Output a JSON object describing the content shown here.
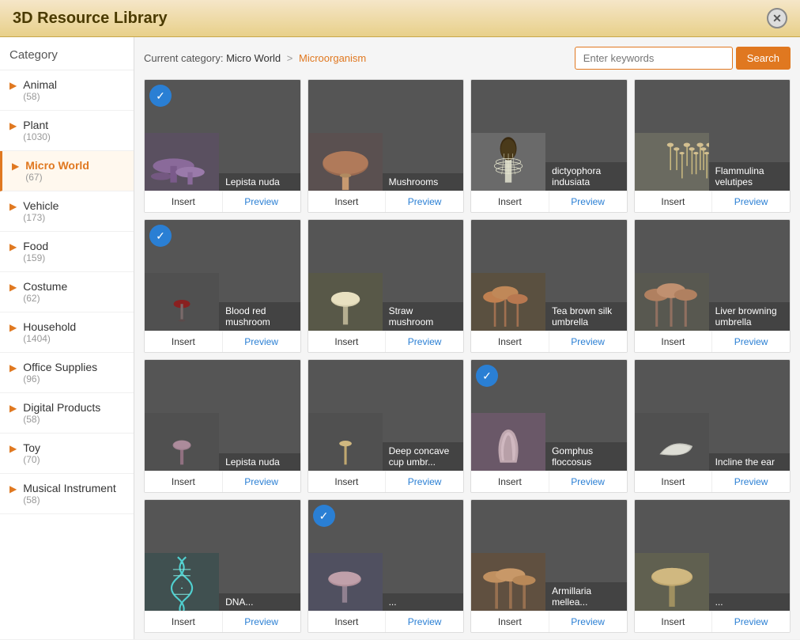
{
  "app": {
    "title": "3D Resource Library"
  },
  "sidebar": {
    "header": "Category",
    "items": [
      {
        "id": "animal",
        "name": "Animal",
        "count": "(58)",
        "active": false
      },
      {
        "id": "plant",
        "name": "Plant",
        "count": "(1030)",
        "active": false
      },
      {
        "id": "micro-world",
        "name": "Micro World",
        "count": "(67)",
        "active": true
      },
      {
        "id": "vehicle",
        "name": "Vehicle",
        "count": "(173)",
        "active": false
      },
      {
        "id": "food",
        "name": "Food",
        "count": "(159)",
        "active": false
      },
      {
        "id": "costume",
        "name": "Costume",
        "count": "(62)",
        "active": false
      },
      {
        "id": "household",
        "name": "Household",
        "count": "(1404)",
        "active": false
      },
      {
        "id": "office-supplies",
        "name": "Office Supplies",
        "count": "(96)",
        "active": false
      },
      {
        "id": "digital-products",
        "name": "Digital Products",
        "count": "(58)",
        "active": false
      },
      {
        "id": "toy",
        "name": "Toy",
        "count": "(70)",
        "active": false
      },
      {
        "id": "musical-instrument",
        "name": "Musical Instrument",
        "count": "(58)",
        "active": false
      }
    ]
  },
  "breadcrumb": {
    "label": "Current category:",
    "category": "Micro World",
    "arrow": ">",
    "subcategory": "Microorganism"
  },
  "search": {
    "placeholder": "Enter keywords",
    "button_label": "Search"
  },
  "grid": {
    "items": [
      {
        "id": 1,
        "name": "Lepista nuda",
        "badge": true,
        "insert": "Insert",
        "preview": "Preview",
        "color": "#6a5a7a"
      },
      {
        "id": 2,
        "name": "Mushrooms",
        "badge": false,
        "insert": "Insert",
        "preview": "Preview",
        "color": "#7a5a4a"
      },
      {
        "id": 3,
        "name": "dictyophora indusiata",
        "badge": false,
        "insert": "Insert",
        "preview": "Preview",
        "color": "#8a8a7a"
      },
      {
        "id": 4,
        "name": "Flammulina velutipes",
        "badge": false,
        "insert": "Insert",
        "preview": "Preview",
        "color": "#7a7a6a"
      },
      {
        "id": 5,
        "name": "Blood red mushroom",
        "badge": true,
        "insert": "Insert",
        "preview": "Preview",
        "color": "#5a5a5a"
      },
      {
        "id": 6,
        "name": "Straw mushroom",
        "badge": false,
        "insert": "Insert",
        "preview": "Preview",
        "color": "#6a6a5a"
      },
      {
        "id": 7,
        "name": "Tea brown silk umbrella",
        "badge": false,
        "insert": "Insert",
        "preview": "Preview",
        "color": "#7a6a4a"
      },
      {
        "id": 8,
        "name": "Liver browning umbrella",
        "badge": false,
        "insert": "Insert",
        "preview": "Preview",
        "color": "#7a6a5a"
      },
      {
        "id": 9,
        "name": "Lepista nuda",
        "badge": false,
        "insert": "Insert",
        "preview": "Preview",
        "color": "#5a5a5a"
      },
      {
        "id": 10,
        "name": "Deep concave cup umbr...",
        "badge": false,
        "insert": "Insert",
        "preview": "Preview",
        "color": "#5a5a5a"
      },
      {
        "id": 11,
        "name": "Gomphus floccosus",
        "badge": true,
        "insert": "Insert",
        "preview": "Preview",
        "color": "#6a5a6a"
      },
      {
        "id": 12,
        "name": "Incline the ear",
        "badge": false,
        "insert": "Insert",
        "preview": "Preview",
        "color": "#5a5a5a"
      },
      {
        "id": 13,
        "name": "DNA...",
        "badge": false,
        "insert": "Insert",
        "preview": "Preview",
        "color": "#4a6a6a"
      },
      {
        "id": 14,
        "name": "...",
        "badge": true,
        "insert": "Insert",
        "preview": "Preview",
        "color": "#5a5a6a"
      },
      {
        "id": 15,
        "name": "Armillaria mellea...",
        "badge": false,
        "insert": "Insert",
        "preview": "Preview",
        "color": "#7a6a4a"
      },
      {
        "id": 16,
        "name": "...",
        "badge": false,
        "insert": "Insert",
        "preview": "Preview",
        "color": "#8a7a5a"
      }
    ]
  }
}
